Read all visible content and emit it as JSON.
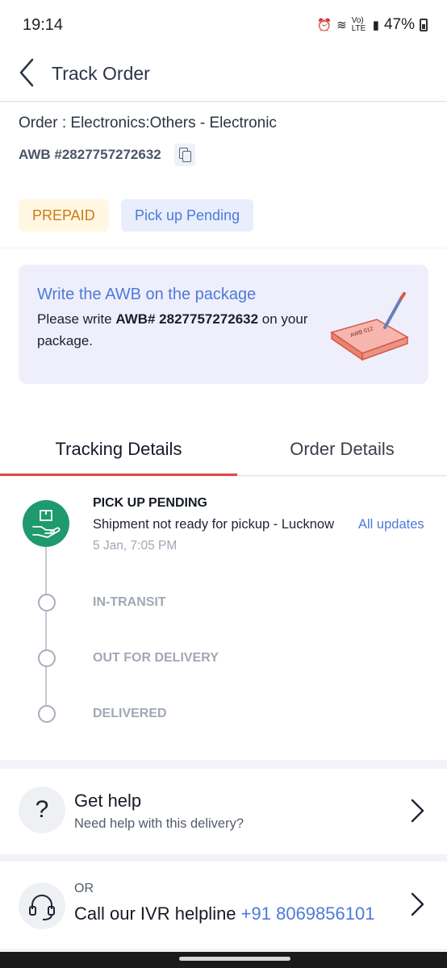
{
  "status_bar": {
    "time": "19:14",
    "network": "Vo) LTE",
    "battery": "47%"
  },
  "header": {
    "title": "Track Order"
  },
  "order": {
    "label": "Order : Electronics:Others - Electronic",
    "awb": "AWB #2827757272632",
    "badges": {
      "payment": "PREPAID",
      "status": "Pick up Pending"
    }
  },
  "info": {
    "title": "Write the AWB on the package",
    "text_prefix": "Please write ",
    "awb_bold": "AWB# 2827757272632",
    "text_suffix": " on your package.",
    "illustration_label": "AWB 012"
  },
  "tabs": [
    {
      "label": "Tracking Details",
      "active": true
    },
    {
      "label": "Order Details",
      "active": false
    }
  ],
  "tracking": {
    "current": {
      "title": "PICK UP PENDING",
      "description": "Shipment not ready for pickup - Lucknow",
      "time": "5 Jan, 7:05 PM",
      "link": "All updates"
    },
    "next_steps": [
      "IN-TRANSIT",
      "OUT FOR DELIVERY",
      "DELIVERED"
    ]
  },
  "help": {
    "title": "Get help",
    "subtitle": "Need help with this delivery?"
  },
  "ivr": {
    "or": "OR",
    "title": "Call our IVR helpline",
    "phone": "+91 8069856101"
  },
  "colors": {
    "accent": "#4d7ad9",
    "active_tab": "#e0483d",
    "step_done": "#1f9a6e",
    "prepaid": "#cf7a12"
  }
}
